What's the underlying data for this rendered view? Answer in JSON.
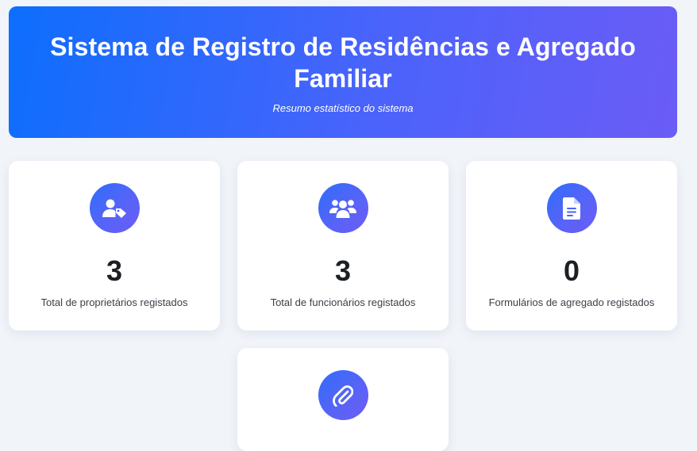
{
  "header": {
    "title": "Sistema de Registro de Residências e Agregado Familiar",
    "subtitle": "Resumo estatístico do sistema",
    "gradient_start": "#0d6efd",
    "gradient_end": "#6b5cf6"
  },
  "cards": [
    {
      "icon": "user-tag-icon",
      "value": "3",
      "label": "Total de proprietários registados"
    },
    {
      "icon": "users-icon",
      "value": "3",
      "label": "Total de funcionários registados"
    },
    {
      "icon": "file-icon",
      "value": "0",
      "label": "Formulários de agregado registados"
    },
    {
      "icon": "paperclip-icon",
      "value": "",
      "label": ""
    }
  ]
}
